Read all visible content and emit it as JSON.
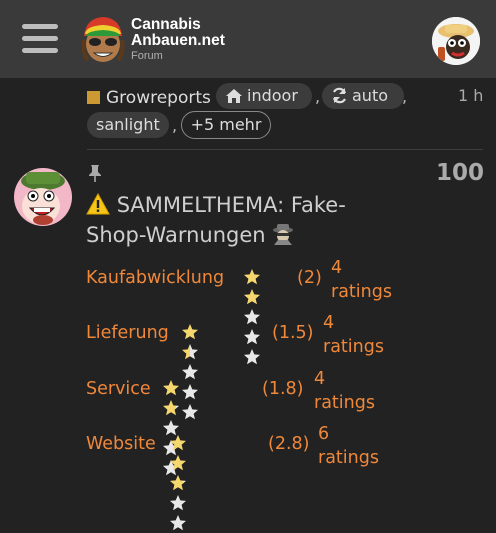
{
  "header": {
    "site_title_line1": "Cannabis",
    "site_title_line2": "Anbauen.net",
    "site_subtitle": "Forum"
  },
  "tags": {
    "category": "Growreports",
    "category_color": "#cc9933",
    "items": [
      {
        "label": "indoor",
        "icon": "home-icon"
      },
      {
        "label": "auto",
        "icon": "sync-icon"
      },
      {
        "label": "sanlight",
        "icon": ""
      }
    ],
    "separator": ",",
    "more": "+5 mehr",
    "time": "1 h"
  },
  "topic": {
    "reply_count": "100",
    "title_line1": "SAMMELTHEMA: Fake-",
    "title_line2": "Shop-Warnungen"
  },
  "ratings": [
    {
      "label": "Kaufabwicklung",
      "stars": 2,
      "score": "(2)",
      "count_line1": "4",
      "count_line2": "ratings"
    },
    {
      "label": "Lieferung",
      "stars": 1.5,
      "score": "(1.5)",
      "count_line1": "4",
      "count_line2": "ratings"
    },
    {
      "label": "Service",
      "stars": 1.8,
      "score": "(1.8)",
      "count_line1": "4",
      "count_line2": "ratings"
    },
    {
      "label": "Website",
      "stars": 2.8,
      "score": "(2.8)",
      "count_line1": "6",
      "count_line2": "ratings"
    }
  ],
  "colors": {
    "accent_orange": "#f0883a",
    "star_filled": "#f5d76e",
    "star_empty": "#e8e8e8",
    "header_bg": "#3a3a3a",
    "page_bg": "#222222"
  }
}
